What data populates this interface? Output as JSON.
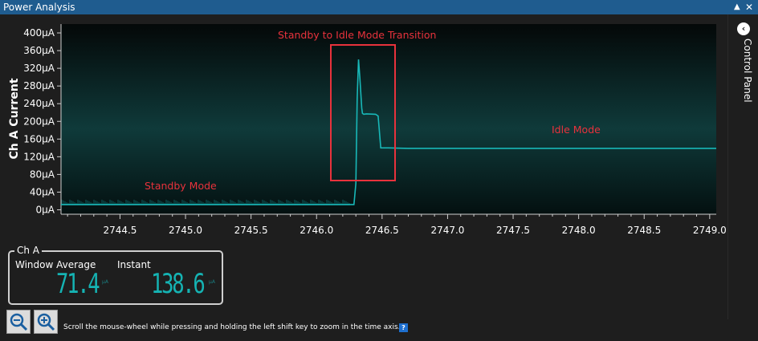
{
  "window": {
    "title": "Power Analysis"
  },
  "sidebar": {
    "label": "Control Panel"
  },
  "chart_data": {
    "type": "line",
    "ylabel": "Ch A Current",
    "xlabel": "",
    "y_ticks": [
      "0µA",
      "40µA",
      "80µA",
      "120µA",
      "160µA",
      "200µA",
      "240µA",
      "280µA",
      "320µA",
      "360µA",
      "400µA"
    ],
    "x_ticks": [
      "2744.5",
      "2745.0",
      "2745.5",
      "2746.0",
      "2746.5",
      "2747.0",
      "2747.5",
      "2748.0",
      "2748.5",
      "2749.0"
    ],
    "xlim": [
      2744.05,
      2749.05
    ],
    "ylim": [
      -10,
      420
    ],
    "series": [
      {
        "x": [
          2744.05,
          2746.25,
          2746.27,
          2746.285,
          2746.3,
          2746.31,
          2746.32,
          2746.33,
          2746.345,
          2746.35,
          2746.36,
          2746.38,
          2746.45,
          2746.47,
          2746.48,
          2746.49,
          2746.55,
          2746.7,
          2747.5,
          2748.5,
          2749.05
        ],
        "y": [
          12,
          12,
          12,
          12,
          60,
          250,
          340,
          300,
          230,
          218,
          216,
          217,
          216,
          212,
          175,
          140,
          140,
          139,
          139,
          139,
          139
        ]
      }
    ],
    "annotations": [
      {
        "text": "Standby to Idle Mode Transition"
      },
      {
        "text": "Idle Mode"
      },
      {
        "text": "Standby Mode"
      }
    ],
    "colors": {
      "line": "#18b8b8",
      "annotation": "#e8323c",
      "highlight_box": "#e8323c"
    }
  },
  "channel": {
    "legend": "Ch A",
    "window_average_label": "Window Average",
    "window_average_value": "71.4",
    "window_average_unit": "µA",
    "instant_label": "Instant",
    "instant_value": "138.6",
    "instant_unit": "µA"
  },
  "toolbar": {
    "hint": "Scroll the mouse-wheel while pressing and holding the left shift key to zoom in the time axis.",
    "help": "?"
  }
}
